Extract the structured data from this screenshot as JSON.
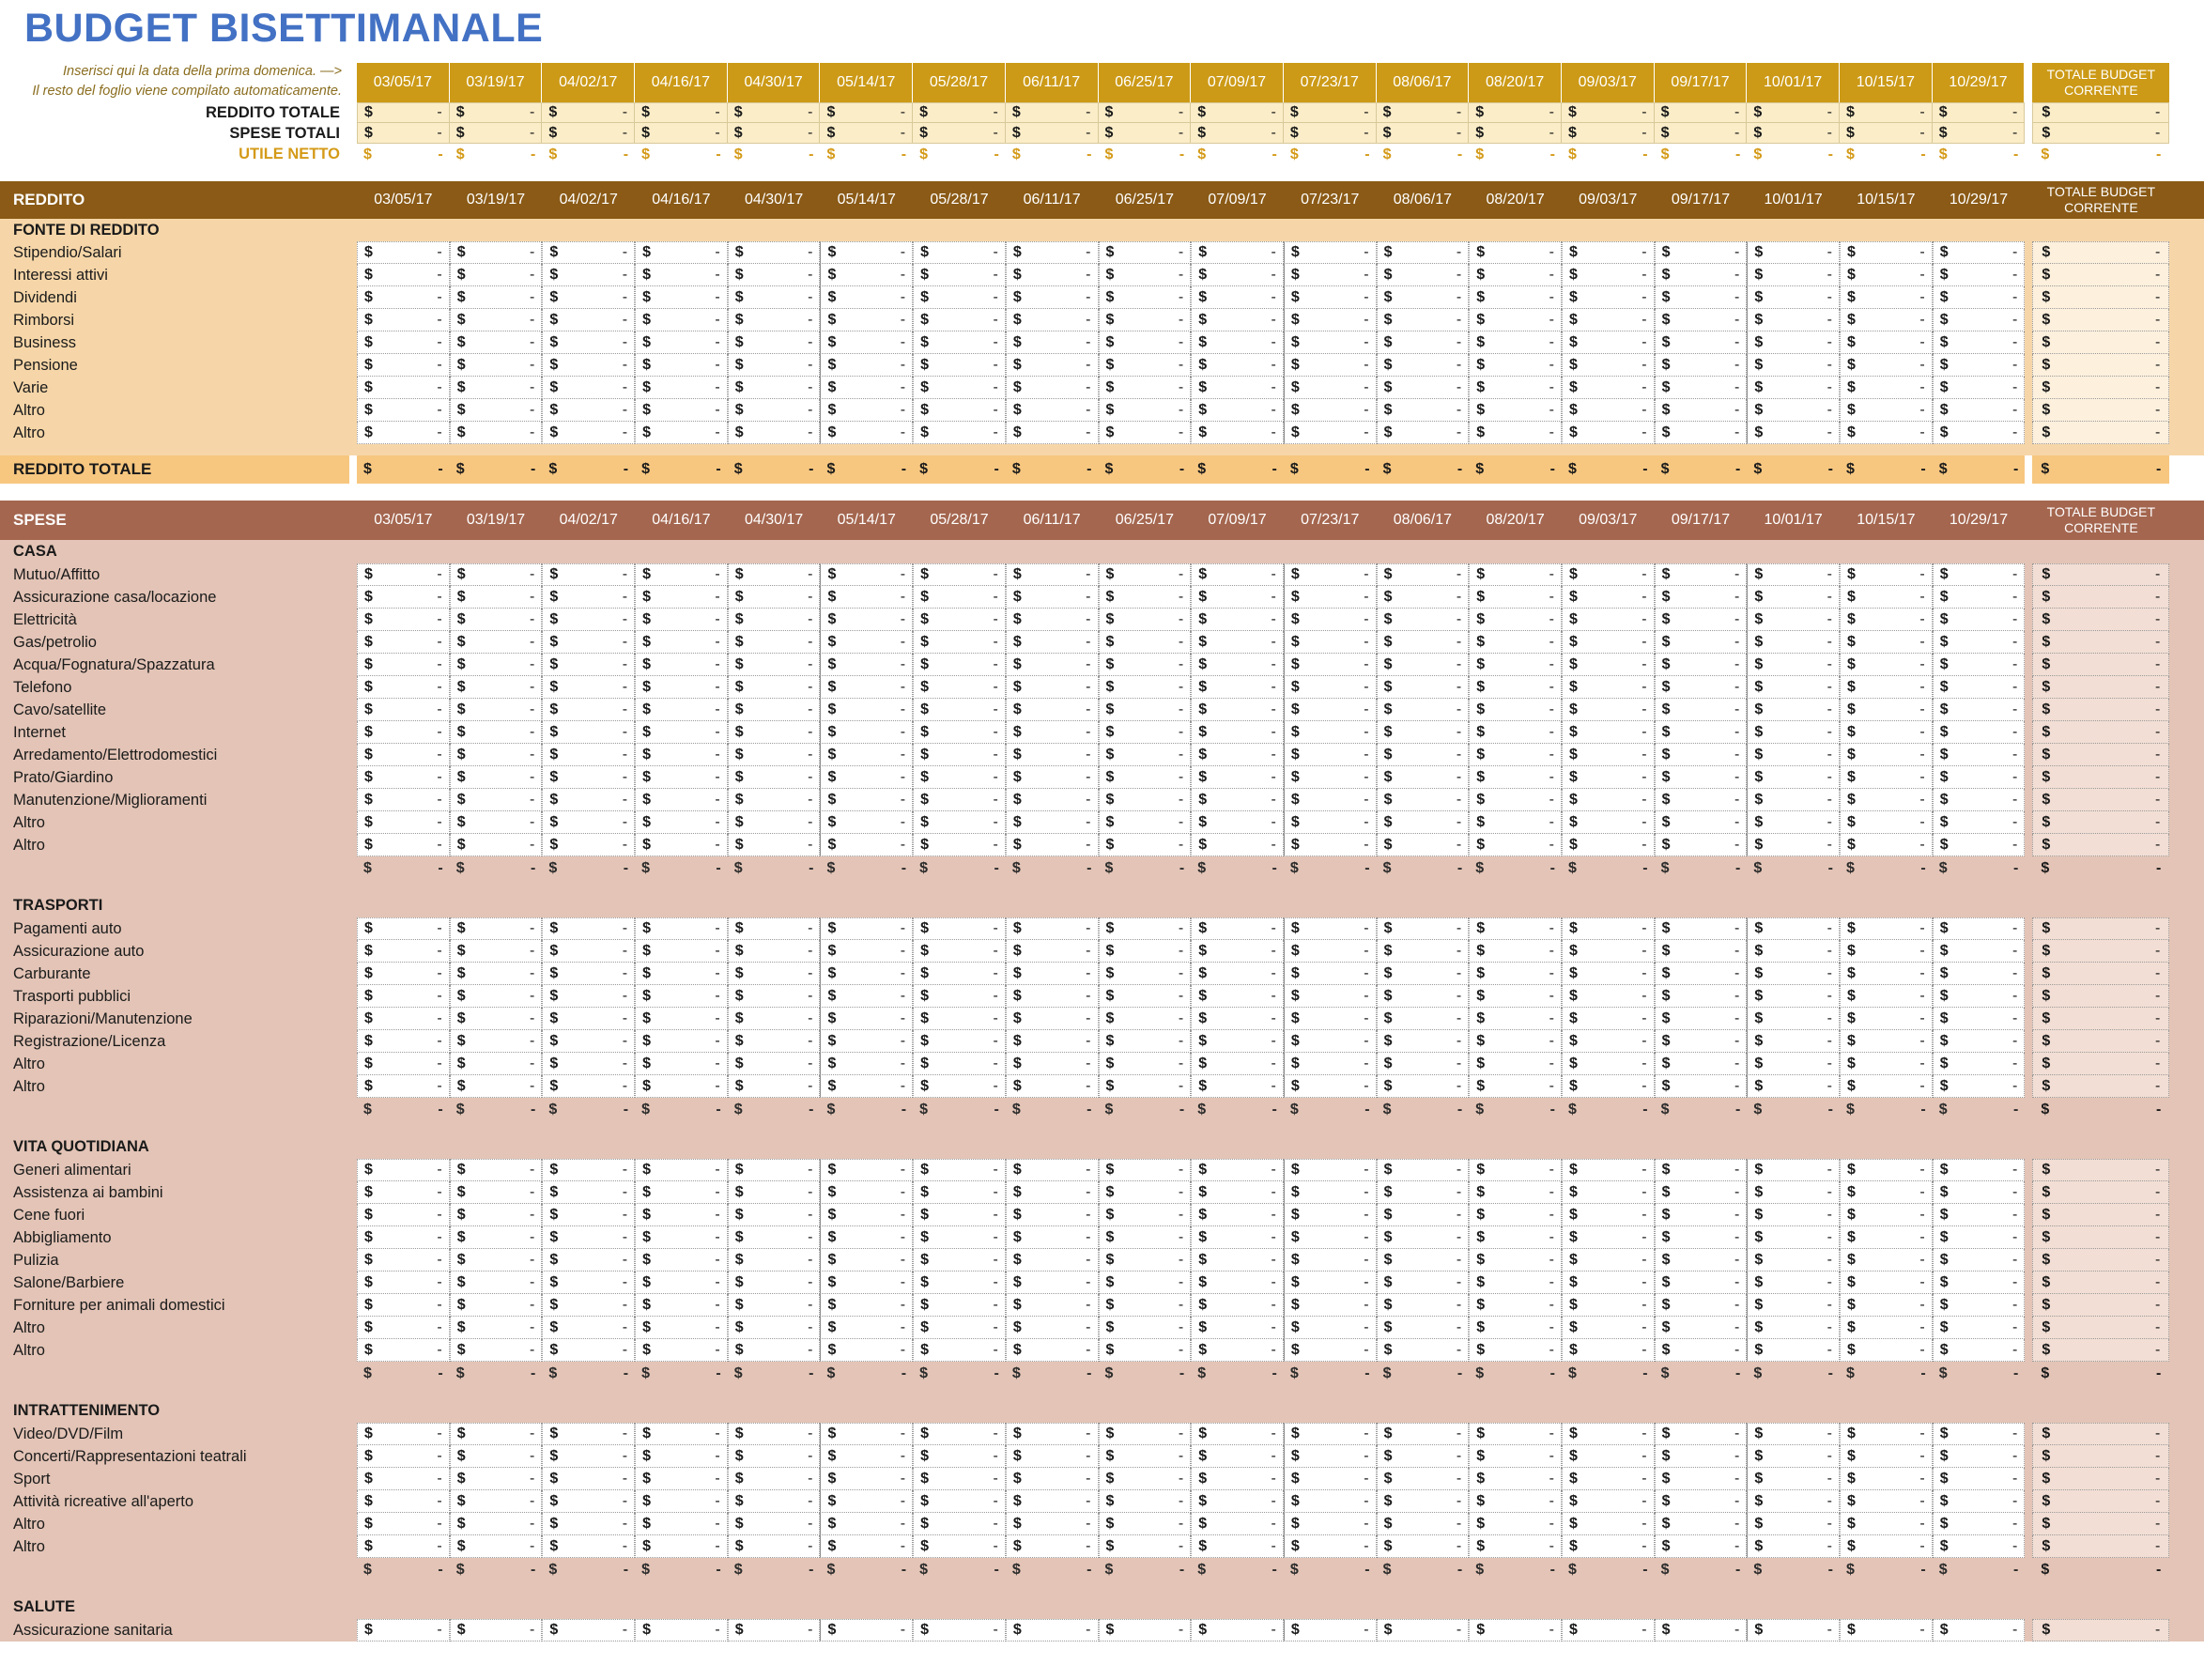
{
  "page": {
    "title": "BUDGET BISETTIMANALE"
  },
  "colors": {
    "title": "#4371c4",
    "summary_header": "#cc9a17",
    "summary_cell": "#fbedc8",
    "net_profit": "#d49a17",
    "income_band": "#8a5a16",
    "income_body": "#f6d6a8",
    "income_total": "#f7c780",
    "expense_band": "#a4664f",
    "expense_body": "#e3c4b6"
  },
  "note": {
    "line1": "Inserisci qui la data della prima domenica. —>",
    "line2": "Il resto del foglio viene compilato automaticamente."
  },
  "dates": [
    "03/05/17",
    "03/19/17",
    "04/02/17",
    "04/16/17",
    "04/30/17",
    "05/14/17",
    "05/28/17",
    "06/11/17",
    "06/25/17",
    "07/09/17",
    "07/23/17",
    "08/06/17",
    "08/20/17",
    "09/03/17",
    "09/17/17",
    "10/01/17",
    "10/15/17",
    "10/29/17"
  ],
  "total_col": {
    "line1": "TOTALE BUDGET",
    "line2": "CORRENTE"
  },
  "cell_value": {
    "currency": "$",
    "amount": "-"
  },
  "summary": {
    "rows": [
      {
        "label": "REDDITO TOTALE"
      },
      {
        "label": "SPESE TOTALI"
      },
      {
        "label": "UTILE NETTO"
      }
    ]
  },
  "income": {
    "band_label": "REDDITO",
    "sub_header": "FONTE DI REDDITO",
    "items": [
      "Stipendio/Salari",
      "Interessi attivi",
      "Dividendi",
      "Rimborsi",
      "Business",
      "Pensione",
      "Varie",
      "Altro",
      "Altro"
    ],
    "total_label": "REDDITO TOTALE"
  },
  "expenses": {
    "band_label": "SPESE",
    "categories": [
      {
        "name": "CASA",
        "items": [
          "Mutuo/Affitto",
          "Assicurazione casa/locazione",
          "Elettricità",
          "Gas/petrolio",
          "Acqua/Fognatura/Spazzatura",
          "Telefono",
          "Cavo/satellite",
          "Internet",
          "Arredamento/Elettrodomestici",
          "Prato/Giardino",
          "Manutenzione/Miglioramenti",
          "Altro",
          "Altro"
        ]
      },
      {
        "name": "TRASPORTI",
        "items": [
          "Pagamenti auto",
          "Assicurazione auto",
          "Carburante",
          "Trasporti pubblici",
          "Riparazioni/Manutenzione",
          "Registrazione/Licenza",
          "Altro",
          "Altro"
        ]
      },
      {
        "name": "VITA QUOTIDIANA",
        "items": [
          "Generi alimentari",
          "Assistenza ai bambini",
          "Cene fuori",
          "Abbigliamento",
          "Pulizia",
          "Salone/Barbiere",
          "Forniture per animali domestici",
          "Altro",
          "Altro"
        ]
      },
      {
        "name": "INTRATTENIMENTO",
        "items": [
          "Video/DVD/Film",
          "Concerti/Rappresentazioni teatrali",
          "Sport",
          "Attività ricreative all'aperto",
          "Altro",
          "Altro"
        ]
      },
      {
        "name": "SALUTE",
        "items": [
          "Assicurazione sanitaria"
        ]
      }
    ]
  }
}
